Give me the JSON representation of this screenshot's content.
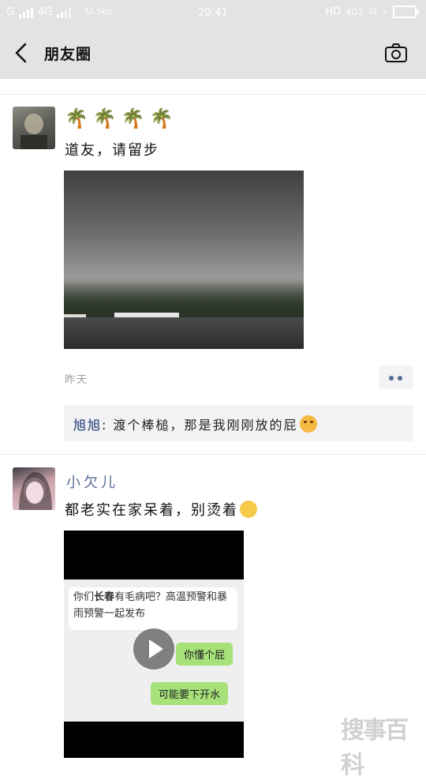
{
  "status_bar": {
    "carrier_left": "G",
    "network_left": "4G",
    "speed": "52.5k/s",
    "time": "20:41",
    "hd": "HD",
    "network_right": "4G2",
    "battery_number": "13"
  },
  "nav": {
    "title": "朋友圈",
    "back_icon": "chevron-left-icon",
    "camera_icon": "camera-icon"
  },
  "post1": {
    "emoji_line": "🌴🌴🌴🌴",
    "text": "道友，请留步",
    "time": "昨天",
    "comment": {
      "name": "旭旭",
      "separator": ":",
      "text": " 渡个棒槌，那是我刚刚放的屁"
    }
  },
  "post2": {
    "username": "小欠儿",
    "text": "都老实在家呆着，别烫着",
    "video": {
      "incoming_prefix": "你们",
      "incoming_bold": "长春",
      "incoming_rest": "有毛病吧？高温预警和暴雨预警一起发布",
      "reply1": "你懂个屁",
      "reply2": "可能要下开水"
    }
  },
  "watermark": "搜事百科",
  "colors": {
    "nav_bg": "#e3e3e3",
    "link_blue": "#576b95",
    "comment_bg": "#f3f3f5",
    "reply_green": "#a6e17a"
  }
}
